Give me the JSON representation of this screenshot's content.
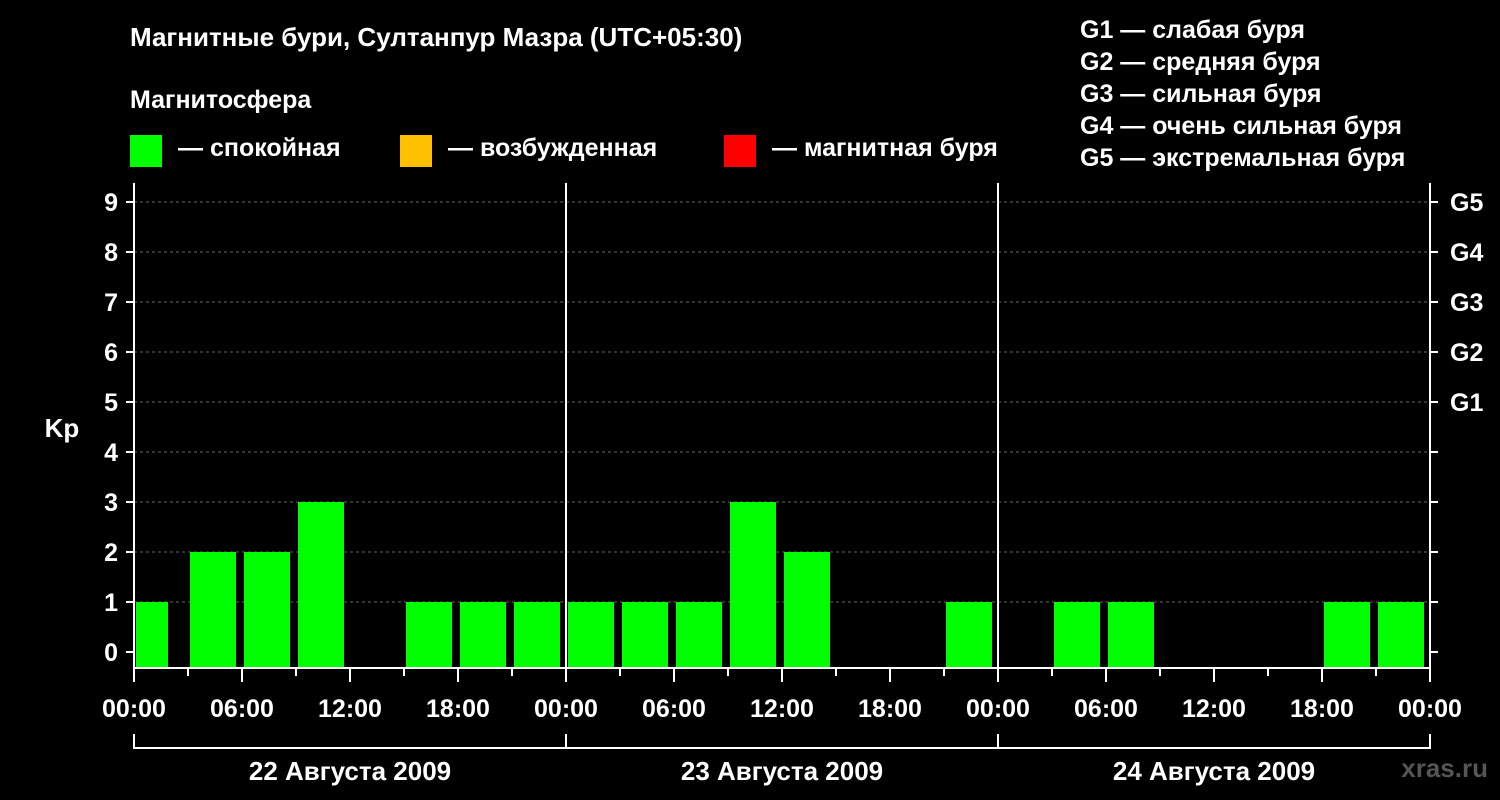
{
  "title": "Магнитные бури, Султанпур Мазра (UTC+05:30)",
  "magnetosphere_heading": "Магнитосфера",
  "legend": [
    {
      "label": "— спокойная",
      "color": "#00ff00"
    },
    {
      "label": "— возбужденная",
      "color": "#ffc000"
    },
    {
      "label": "— магнитная буря",
      "color": "#ff0000"
    }
  ],
  "g_legend": [
    "G1 — слабая буря",
    "G2 — средняя буря",
    "G3 — сильная буря",
    "G4 — очень сильная буря",
    "G5 — экстремальная буря"
  ],
  "watermark": "xras.ru",
  "chart_data": {
    "type": "bar",
    "ylabel": "Kp",
    "ylim": [
      0,
      9
    ],
    "yticks": [
      "0",
      "1",
      "2",
      "3",
      "4",
      "5",
      "6",
      "7",
      "8",
      "9"
    ],
    "right_ticks": [
      {
        "kp": 5,
        "label": "G1"
      },
      {
        "kp": 6,
        "label": "G2"
      },
      {
        "kp": 7,
        "label": "G3"
      },
      {
        "kp": 8,
        "label": "G4"
      },
      {
        "kp": 9,
        "label": "G5"
      }
    ],
    "x_tick_labels": [
      "00:00",
      "06:00",
      "12:00",
      "18:00",
      "00:00",
      "06:00",
      "12:00",
      "18:00",
      "00:00",
      "06:00",
      "12:00",
      "18:00",
      "00:00"
    ],
    "days": [
      "22 Августа 2009",
      "23 Августа 2009",
      "24 Августа 2009"
    ],
    "categories": [
      "22 Августа 2009 00:00",
      "22 Августа 2009 03:00",
      "22 Августа 2009 06:00",
      "22 Августа 2009 09:00",
      "22 Августа 2009 12:00",
      "22 Августа 2009 15:00",
      "22 Августа 2009 18:00",
      "22 Августа 2009 21:00",
      "23 Августа 2009 00:00",
      "23 Августа 2009 03:00",
      "23 Августа 2009 06:00",
      "23 Августа 2009 09:00",
      "23 Августа 2009 12:00",
      "23 Августа 2009 15:00",
      "23 Августа 2009 18:00",
      "23 Августа 2009 21:00",
      "24 Августа 2009 00:00",
      "24 Августа 2009 03:00",
      "24 Августа 2009 06:00",
      "24 Августа 2009 09:00",
      "24 Августа 2009 12:00",
      "24 Августа 2009 15:00",
      "24 Августа 2009 18:00",
      "24 Августа 2009 21:00"
    ],
    "values": [
      1,
      2,
      2,
      3,
      0,
      1,
      1,
      1,
      1,
      1,
      1,
      3,
      2,
      0,
      0,
      1,
      0,
      1,
      1,
      0,
      0,
      0,
      1,
      1
    ],
    "bar_color": "#00ff00",
    "grid": true
  }
}
